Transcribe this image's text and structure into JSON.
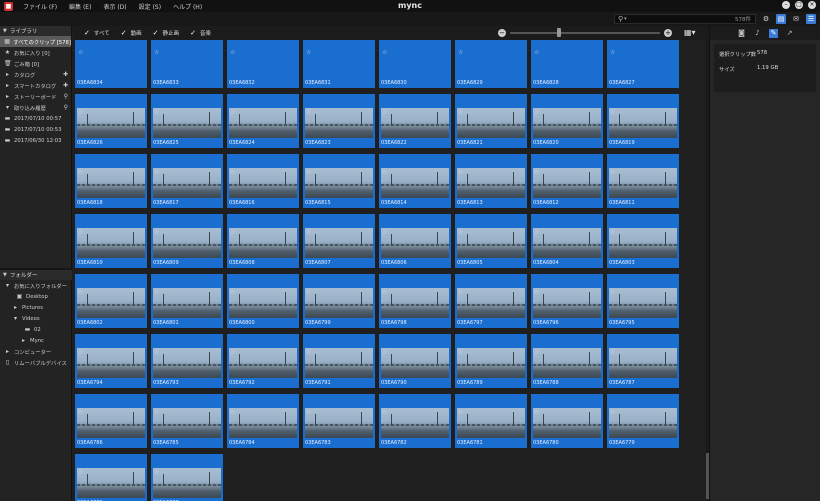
{
  "titlebar": {
    "app_title": "mync",
    "menus": [
      "ファイル (F)",
      "編集 (E)",
      "表示 (D)",
      "設定 (S)",
      "ヘルプ (H)"
    ]
  },
  "search": {
    "placeholder": "",
    "count_text": "578件"
  },
  "sidebar": {
    "library_header": "ライブラリ",
    "library_items": [
      {
        "label": "すべてのクリップ [578]",
        "icon": "clips-icon",
        "selected": true
      },
      {
        "label": "お気に入り [0]",
        "icon": "star-icon"
      },
      {
        "label": "ごみ箱 [0]",
        "icon": "trash-icon"
      }
    ],
    "catalog": "カタログ",
    "smart_catalog": "スマートカタログ",
    "storyboard": "ストーリーボード",
    "import_history": "取り込み履歴",
    "history_items": [
      "2017/07/10 00:57",
      "2017/07/10 00:53",
      "2017/06/30 12:03"
    ],
    "folder_header": "フォルダー",
    "fav_folders": "お気に入りフォルダー",
    "folder_items": [
      "Desktop",
      "Pictures",
      "Videos",
      "02",
      "Mync"
    ],
    "computer": "コンピューター",
    "removable": "リムーバブルデバイス"
  },
  "filters": {
    "all": "すべて",
    "video": "動画",
    "still": "静止画",
    "audio": "音楽"
  },
  "clips": [
    "03EA6834",
    "03EA6833",
    "03EA6832",
    "03EA6831",
    "03EA6830",
    "03EA6829",
    "03EA6828",
    "03EA6827",
    "03EA6826",
    "03EA6825",
    "03EA6824",
    "03EA6823",
    "03EA6822",
    "03EA6821",
    "03EA6820",
    "03EA6819",
    "03EA6818",
    "03EA6817",
    "03EA6816",
    "03EA6815",
    "03EA6814",
    "03EA6813",
    "03EA6812",
    "03EA6811",
    "03EA6810",
    "03EA6809",
    "03EA6808",
    "03EA6807",
    "03EA6806",
    "03EA6805",
    "03EA6804",
    "03EA6803",
    "03EA6802",
    "03EA6801",
    "03EA6800",
    "03EA6799",
    "03EA6798",
    "03EA6797",
    "03EA6796",
    "03EA6795",
    "03EA6794",
    "03EA6793",
    "03EA6792",
    "03EA6791",
    "03EA6790",
    "03EA6789",
    "03EA6788",
    "03EA6787",
    "03EA6786",
    "03EA6785",
    "03EA6784",
    "03EA6783",
    "03EA6782",
    "03EA6781",
    "03EA6780",
    "03EA6779",
    "03EA6778",
    "03EA6777"
  ],
  "info": {
    "selected_label": "選択クリップ数",
    "selected_value": "578",
    "size_label": "サイズ",
    "size_value": "1.19 GB"
  },
  "colors": {
    "accent": "#1a6ed0",
    "selected_row": "#5a5a5a"
  }
}
